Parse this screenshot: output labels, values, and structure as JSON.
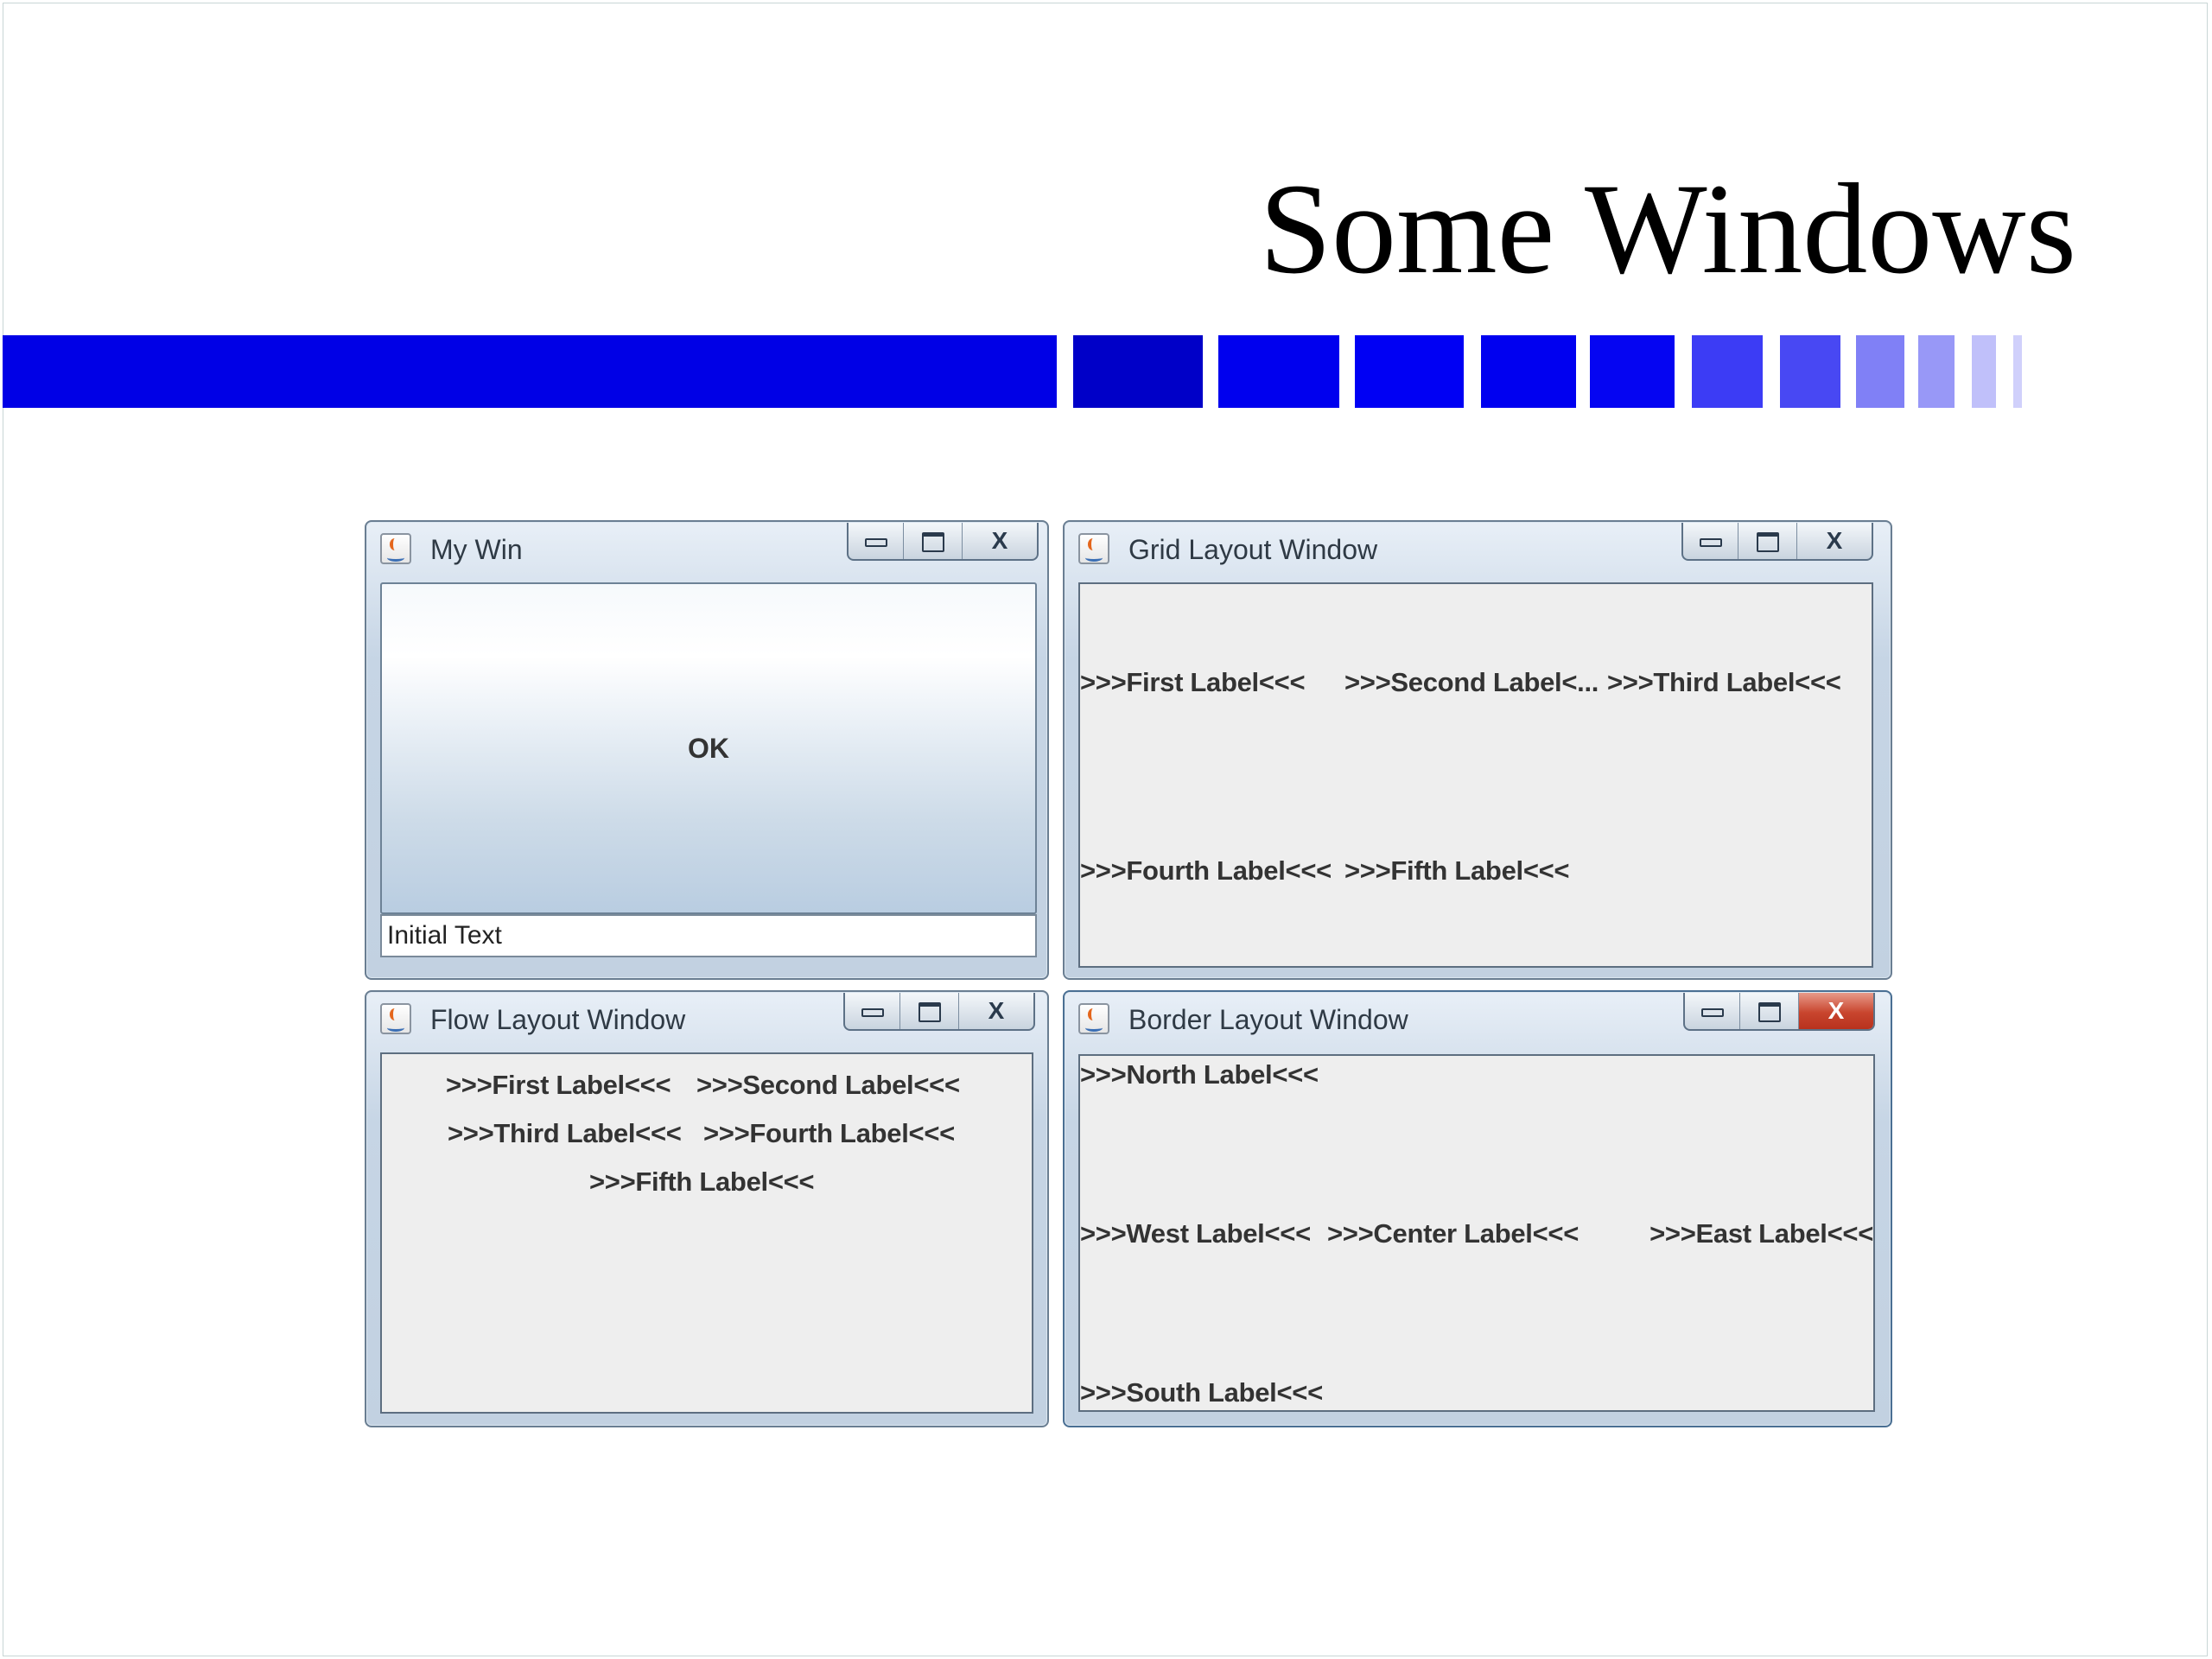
{
  "slide": {
    "title": "Some Windows",
    "accent_color": "#0000ee"
  },
  "windows": {
    "my_win": {
      "title": "My Win",
      "ok_button": "OK",
      "text_field_value": "Initial Text"
    },
    "grid": {
      "title": "Grid Layout Window",
      "labels": [
        ">>>First Label<<<",
        ">>>Second Label<...",
        ">>>Third Label<<<",
        ">>>Fourth Label<<<",
        ">>>Fifth Label<<<"
      ]
    },
    "flow": {
      "title": "Flow Layout Window",
      "labels": [
        ">>>First Label<<<",
        ">>>Second Label<<<",
        ">>>Third Label<<<",
        ">>>Fourth Label<<<",
        ">>>Fifth Label<<<"
      ]
    },
    "border": {
      "title": "Border Layout Window",
      "north": ">>>North Label<<<",
      "west": ">>>West Label<<<",
      "center": ">>>Center Label<<<",
      "east": ">>>East Label<<<",
      "south": ">>>South Label<<<"
    }
  },
  "controls": {
    "close_icon": "x-icon",
    "minimize_icon": "minimize-icon",
    "maximize_icon": "maximize-icon"
  }
}
